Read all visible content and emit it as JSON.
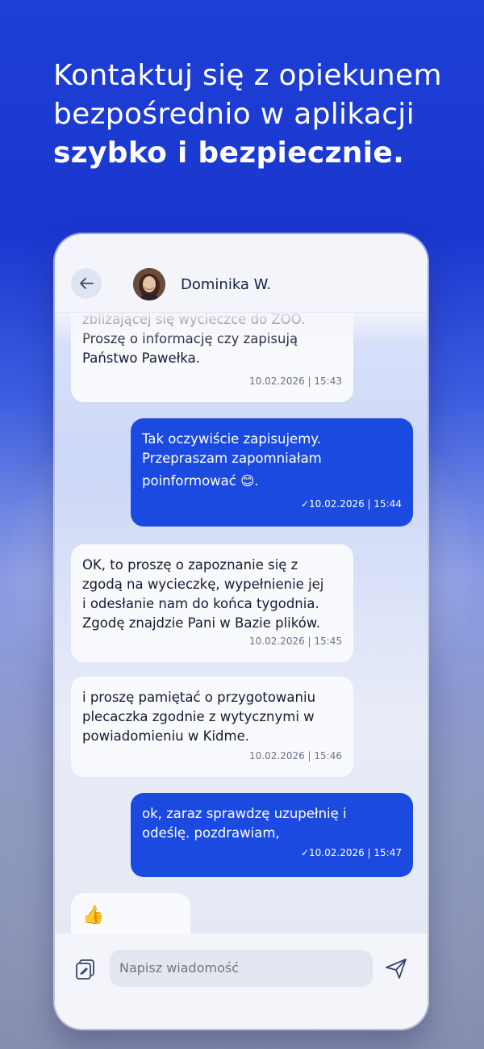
{
  "headline": {
    "line1": "Kontaktuj się z opiekunem",
    "line2": "bezpośrednio w aplikacji",
    "line3": "szybko i bezpiecznie."
  },
  "chat_header": {
    "contact_name": "Dominika W."
  },
  "messages": [
    {
      "direction": "in",
      "lines": [
        "zbliżającej się wycieczce do ZOO.",
        "Proszę o informację czy zapisują",
        "Państwo Pawełka."
      ],
      "timestamp": "10.02.2026 | 15:43"
    },
    {
      "direction": "out",
      "lines": [
        "Tak oczywiście zapisujemy.",
        "Przepraszam zapomniałam",
        "poinformować 😊."
      ],
      "timestamp": "✓10.02.2026 | 15:44"
    },
    {
      "direction": "in",
      "lines": [
        "OK, to proszę o zapoznanie się z",
        "zgodą na wycieczkę, wypełnienie jej",
        "i odesłanie nam do końca tygodnia.",
        "Zgodę znajdzie Pani w Bazie plików."
      ],
      "timestamp": "10.02.2026 | 15:45"
    },
    {
      "direction": "in",
      "lines": [
        "i proszę pamiętać o przygotowaniu",
        "plecaczka zgodnie z wytycznymi w",
        "powiadomieniu w Kidme."
      ],
      "timestamp": "10.02.2026 | 15:46"
    },
    {
      "direction": "out",
      "lines": [
        "ok, zaraz sprawdzę uzupełnię i",
        "odeślę. pozdrawiam,"
      ],
      "timestamp": "✓10.02.2026 | 15:47"
    },
    {
      "direction": "in",
      "lines": [
        "👍"
      ],
      "timestamp": ""
    }
  ],
  "composer": {
    "placeholder": "Napisz wiadomość"
  },
  "icons": {
    "back": "arrow-left-icon",
    "attach": "attachment-icon",
    "send": "send-icon"
  },
  "colors": {
    "accent": "#1b4ae0",
    "background_top": "#1d3fd6",
    "incoming_bubble": "#f9fafd"
  }
}
